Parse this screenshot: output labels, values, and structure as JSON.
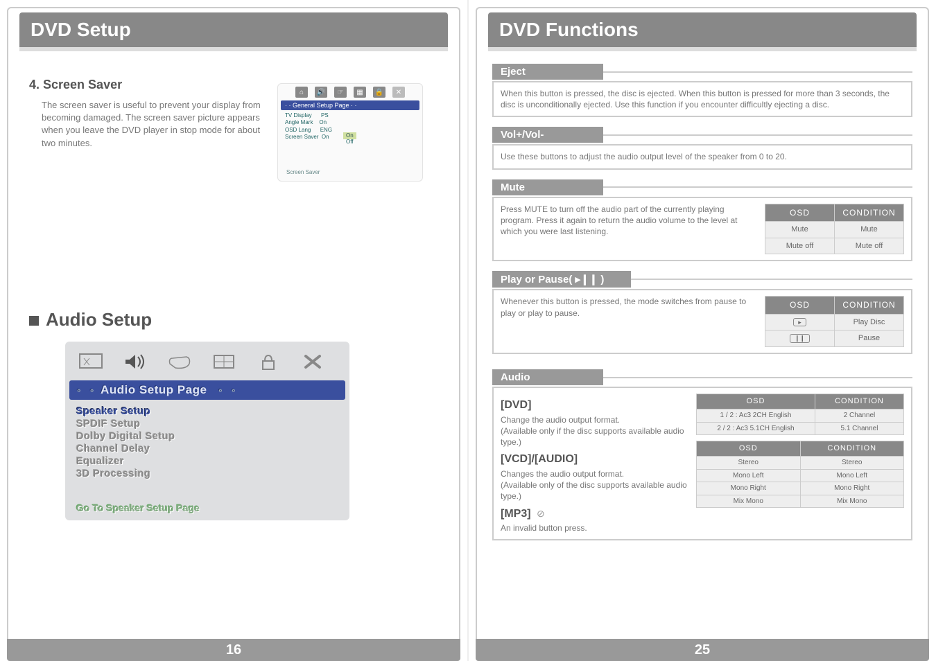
{
  "left": {
    "page_title": "DVD Setup",
    "page_num": "16",
    "screen_saver_title": "4. Screen Saver",
    "screen_saver_para": "The screen saver is useful to prevent your display from becoming damaged. The screen saver picture appears when you leave the DVD player in stop mode for about two minutes.",
    "gsp_banner": "· · General Setup Page · ·",
    "gsp_items": [
      {
        "k": "TV Display",
        "v": "PS"
      },
      {
        "k": "Angle Mark",
        "v": "On"
      },
      {
        "k": "OSD Lang",
        "v": "ENG"
      },
      {
        "k": "Screen Saver",
        "v": "On"
      }
    ],
    "gsp_opt_on": "On",
    "gsp_opt_off": "Off",
    "gsp_foot": "Screen Saver",
    "audio_title": "Audio Setup",
    "audio_banner": "Audio Setup Page",
    "audio_items": [
      "Speaker Setup",
      "SPDIF Setup",
      "Dolby Digital Setup",
      "Channel Delay",
      "Equalizer",
      "3D Processing"
    ],
    "audio_foot": "Go To Speaker Setup Page"
  },
  "right": {
    "page_title": "DVD Functions",
    "page_num": "25",
    "eject_label": "Eject",
    "eject_text": "When this button is pressed, the disc is ejected. When this button is pressed for more than 3 seconds, the disc is unconditionally ejected. Use this function if you encounter difficultly ejecting a disc.",
    "vol_label": "Vol+/Vol-",
    "vol_text": "Use these buttons to adjust the audio output level of the speaker from 0 to 20.",
    "mute_label": "Mute",
    "mute_text": "Press MUTE to turn off the audio part of the currently playing program. Press it again to return the audio volume to the level at which you were last listening.",
    "mute_table": {
      "head": [
        "OSD",
        "CONDITION"
      ],
      "rows": [
        [
          "Mute",
          "Mute"
        ],
        [
          "Mute off",
          "Mute off"
        ]
      ]
    },
    "play_label": "Play or Pause( ▸❙❙ )",
    "play_text": "Whenever this button is pressed, the mode switches from pause to play or play to pause.",
    "play_table": {
      "head": [
        "OSD",
        "CONDITION"
      ],
      "rows": [
        [
          "▸",
          "Play Disc"
        ],
        [
          "❙❙",
          "Pause"
        ]
      ]
    },
    "audio_label": "Audio",
    "dvd_head": "[DVD]",
    "dvd_text": "Change the audio output format.\n(Available only if the disc supports available audio type.)",
    "vcd_head": "[VCD]/[AUDIO]",
    "vcd_text": "Changes the audio output format.\n(Available only of the disc supports available audio type.)",
    "mp3_head": "[MP3]",
    "mp3_icon": "⊘",
    "mp3_text": "An invalid button press.",
    "dvd_table": {
      "head": [
        "OSD",
        "CONDITION"
      ],
      "rows": [
        [
          "1 / 2 : Ac3 2CH English",
          "2 Channel"
        ],
        [
          "2 / 2 : Ac3 5.1CH English",
          "5.1 Channel"
        ]
      ]
    },
    "vcd_table": {
      "head": [
        "OSD",
        "CONDITION"
      ],
      "rows": [
        [
          "Stereo",
          "Stereo"
        ],
        [
          "Mono Left",
          "Mono Left"
        ],
        [
          "Mono Right",
          "Mono Right"
        ],
        [
          "Mix Mono",
          "Mix Mono"
        ]
      ]
    }
  }
}
